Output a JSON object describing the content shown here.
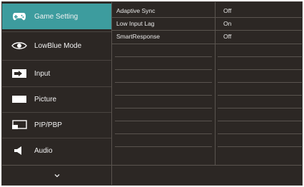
{
  "menu": {
    "items": [
      {
        "label": "Game Setting",
        "icon": "gamepad-icon",
        "active": true
      },
      {
        "label": "LowBlue Mode",
        "icon": "eye-icon",
        "active": false
      },
      {
        "label": "Input",
        "icon": "input-icon",
        "active": false
      },
      {
        "label": "Picture",
        "icon": "picture-icon",
        "active": false
      },
      {
        "label": "PIP/PBP",
        "icon": "pip-icon",
        "active": false
      },
      {
        "label": "Audio",
        "icon": "speaker-icon",
        "active": false
      }
    ],
    "more_icon": "chevron-down-icon"
  },
  "settings": {
    "rows": [
      {
        "name": "Adaptive Sync",
        "value": "Off"
      },
      {
        "name": "Low Input Lag",
        "value": "On"
      },
      {
        "name": "SmartResponse",
        "value": "Off"
      }
    ]
  },
  "colors": {
    "background": "#2c2724",
    "accent": "#3d9c9e",
    "text": "#f2f2f2",
    "divider": "#5a544f"
  }
}
